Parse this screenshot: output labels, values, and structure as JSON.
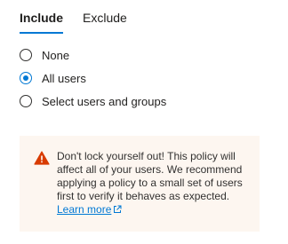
{
  "tabs": [
    {
      "label": "Include",
      "active": true
    },
    {
      "label": "Exclude",
      "active": false
    }
  ],
  "radio_options": [
    {
      "label": "None",
      "checked": false
    },
    {
      "label": "All users",
      "checked": true
    },
    {
      "label": "Select users and groups",
      "checked": false
    }
  ],
  "warning": {
    "icon": "warning-icon",
    "text": "Don't lock yourself out! This policy will affect all of your users. We recommend applying a policy to a small set of users first to verify it behaves as expected.",
    "link_label": "Learn more",
    "link_icon": "external-link-icon"
  },
  "colors": {
    "accent": "#0078d4",
    "warning_bg": "#fdf6f0",
    "warning_icon": "#d83b01"
  }
}
